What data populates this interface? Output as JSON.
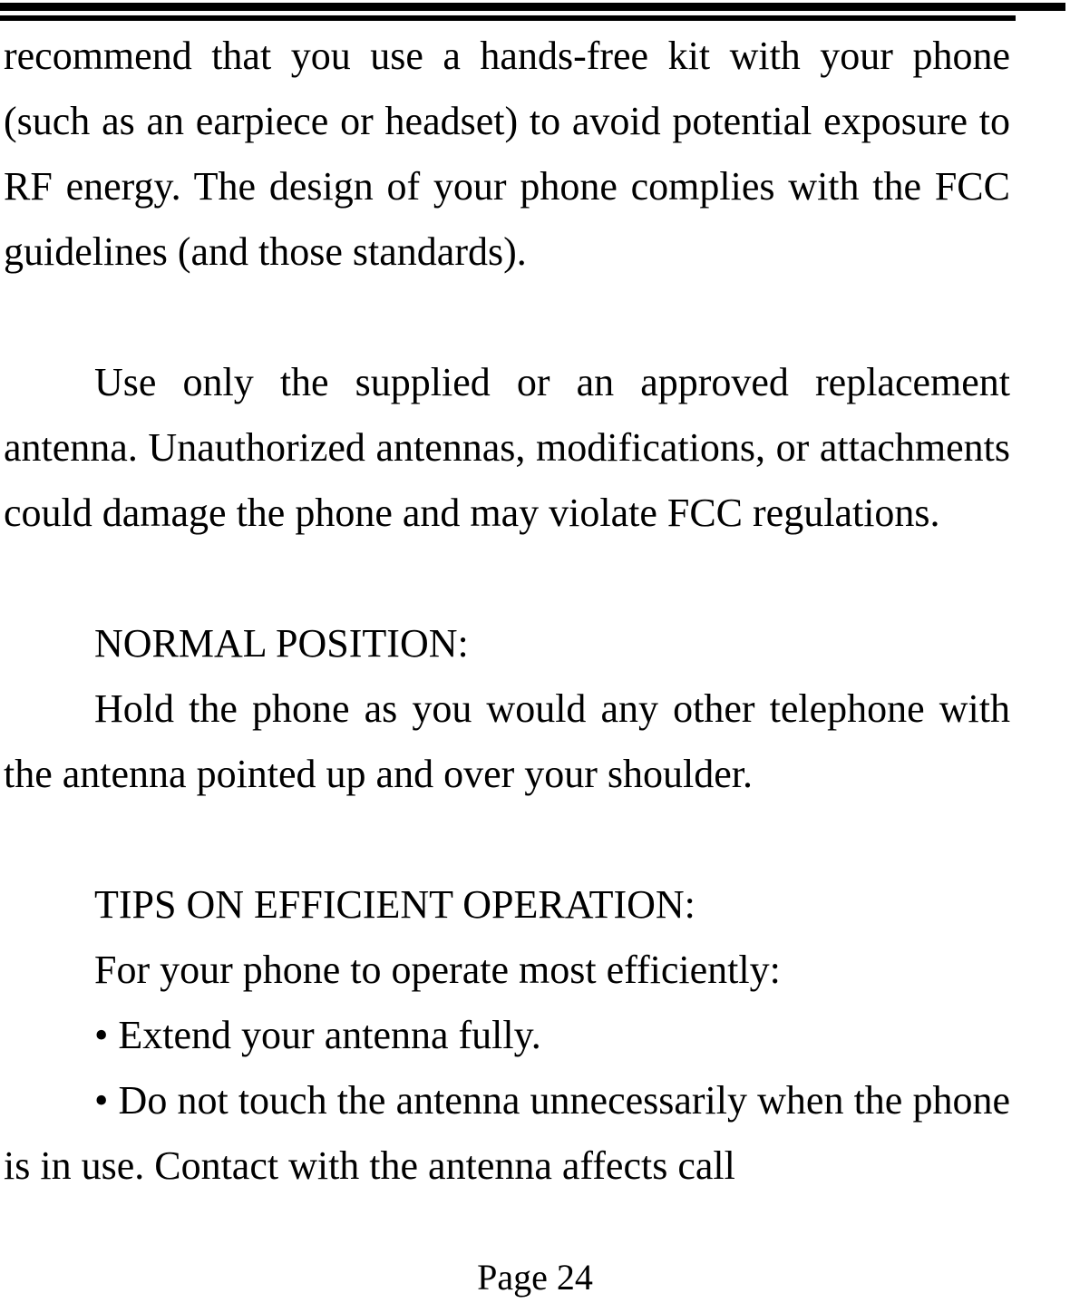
{
  "document": {
    "type": "user-manual-page",
    "page_label": "Page 24",
    "header_rule_count": 2,
    "body_text_color": "#000000",
    "background_color": "#ffffff"
  },
  "body": {
    "paragraph_1": "recommend that you use a hands-free kit with your phone (such as an earpiece or headset) to avoid potential exposure to RF energy. The design of your phone complies with the FCC guidelines (and those standards).",
    "paragraph_2": "Use only the supplied or an approved replacement antenna. Unauthorized antennas, modifications, or attachments could damage the phone and may violate FCC regulations.",
    "heading_normal_position": "NORMAL POSITION:",
    "paragraph_3": "Hold the phone as you would any other telephone with the antenna pointed up and over your shoulder.",
    "heading_tips": "TIPS ON EFFICIENT OPERATION:",
    "tips_intro": "For your phone to operate most efficiently:",
    "bullets": [
      {
        "marker": "•",
        "text": "Extend your antenna fully."
      },
      {
        "marker": "•",
        "text": "Do not touch the antenna unnecessarily when the phone is in use. Contact with the antenna affects call"
      }
    ]
  },
  "footer": {
    "page_number_label": "Page 24"
  }
}
